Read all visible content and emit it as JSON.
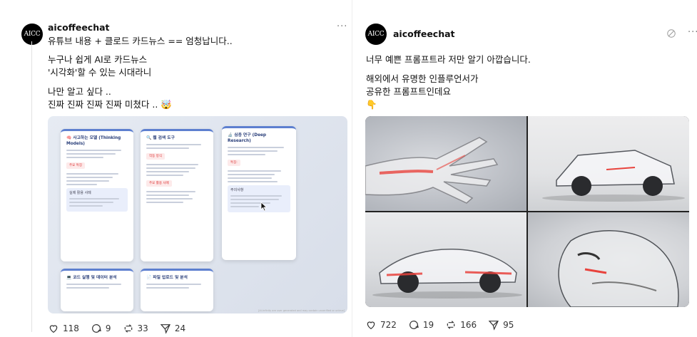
{
  "left_post": {
    "avatar_text": "AICC",
    "username": "aicoffeechat",
    "more": "···",
    "lines": [
      "유튜브 내용 + 클로드 카드뉴스 == 엄청납니다..",
      "누구나 쉽게 AI로 카드뉴스",
      "'시각화'할 수 있는 시대라니",
      "나만 알고 싶다 ..",
      "진짜 진짜 진짜 진짜 미쳤다 .. 🤯"
    ],
    "cards": [
      {
        "title": "🧠 사고하는 모델 (Thinking Models)",
        "tag": "주요 특징",
        "box": "실제 활용 사례"
      },
      {
        "title": "🔍 웹 검색 도구",
        "tag": "작동 방식",
        "box": "주요 활용 사례"
      },
      {
        "title": "🔬 심층 연구 (Deep Research)",
        "tag": "특징:",
        "box": "주의사항"
      },
      {
        "title": "💻 코드 실행 및 데이터 분석",
        "tag": "",
        "box": ""
      },
      {
        "title": "📄 파일 업로드 및 분석",
        "tag": "",
        "box": ""
      }
    ],
    "image_footer": "[AI-Infinity are user generated and may contain unverified or untrue]",
    "stats": {
      "likes": "118",
      "replies": "9",
      "reposts": "33",
      "shares": "24"
    }
  },
  "right_post": {
    "avatar_text": "AICC",
    "username": "aicoffeechat",
    "more": "···",
    "lines": [
      "너무 예쁜 프롬프트라 저만 알기 아깝습니다.",
      "해외에서 유명한 인플루언서가",
      "공유한 프롬프트인데요",
      "👇"
    ],
    "stats": {
      "likes": "722",
      "replies": "19",
      "reposts": "166",
      "shares": "95"
    }
  },
  "colors": {
    "accent_red": "#e8433d",
    "card_border": "#5d7fcf"
  }
}
